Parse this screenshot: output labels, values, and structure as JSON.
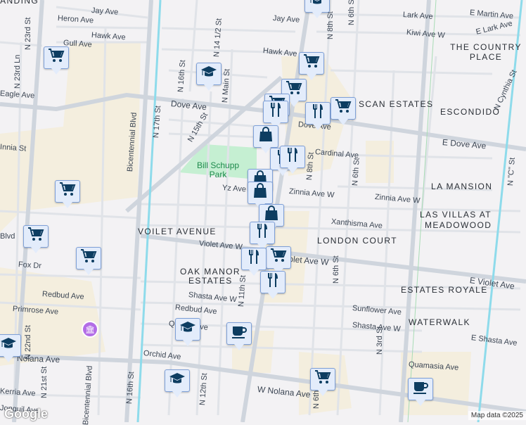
{
  "streets": [
    "Jay Ave",
    "Heron Ave",
    "Hawk Ave",
    "Gull Ave",
    "N 23rd St",
    "N 23rd Ln",
    "Eagle Ave",
    "Dove Ave",
    "Bicentennial Blvd",
    "N 17th St",
    "N 16th St",
    "N 15th St",
    "N 14 1/2 St",
    "N Main St",
    "Yz Ave",
    "Innia St",
    "Jay Ave",
    "Hawk Ave",
    "Lark Ave",
    "E Martin Ave",
    "Kiwi Ave W",
    "E Lark Ave",
    "N 8th St",
    "N 6th St",
    "E Dove Ave",
    "Cardinal Ave",
    "N 8th St",
    "N 6th St",
    "Zinnia Ave W",
    "Zinnia Ave W",
    "N Cynthia St",
    "N \"C\" St",
    "Xanthisma Ave",
    "Violet Ave W",
    "Violet Ave W",
    "E Violet Ave",
    "N 6th St",
    "Sunflower Ave",
    "Shasta Ave W",
    "E Shasta Ave",
    "N 3rd St",
    "Quamasia Ave",
    "W Nolana Ave",
    "N 6th St",
    "Fox Dr",
    "Redbud Ave",
    "Primrose Ave",
    "N 22nd St",
    "Nolana Ave",
    "N 21st St",
    "Kerria Ave",
    "Jonquil Ave",
    "Shasta Ave W",
    "Redbud Ave",
    "Quince Ave",
    "Orchid Ave",
    "N 16th St",
    "N 12th St",
    "N 11th St",
    "Bicentennial Blvd",
    "Blvd",
    "Dove Ave"
  ],
  "neighborhoods": [
    "LANDING",
    "THE COUNTRY PLACE",
    "SCAN ESTATES",
    "ESCONDIDO",
    "LA MANSION",
    "LAS VILLAS AT",
    "MEADOWOOD",
    "LONDON COURT",
    "VOILET AVENUE",
    "OAK MANOR",
    "ESTATES",
    "ESTATES ROYALE",
    "WATERWALK"
  ],
  "park": [
    "Bill Schupp",
    "Park"
  ],
  "markers": [
    "grocery",
    "school",
    "grocery",
    "grocery",
    "grocery",
    "restaurant",
    "restaurant",
    "grocery",
    "shopping",
    "restaurant",
    "restaurant",
    "shopping",
    "shopping",
    "shopping",
    "restaurant",
    "grocery",
    "restaurant",
    "restaurant",
    "grocery",
    "grocery",
    "grocery",
    "school",
    "school",
    "cafe",
    "school",
    "grocery",
    "cafe",
    "school"
  ],
  "museum_icon": "museum-icon",
  "logo": "Google",
  "attribution": "Map data ©2025",
  "colors": {
    "road": "#d6dbe2",
    "water": "#8edbeb",
    "park": "#c5efd2",
    "commercial": "#f4eede",
    "marker": "#0d3d61"
  }
}
